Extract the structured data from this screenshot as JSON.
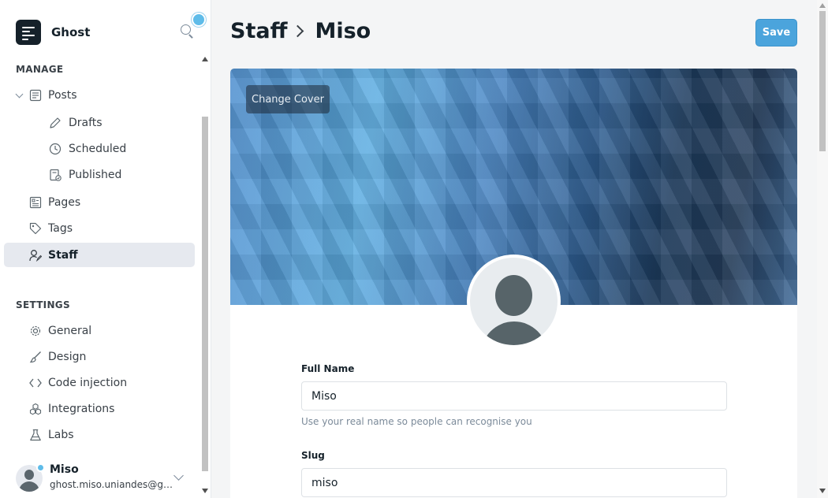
{
  "app": {
    "name": "Ghost"
  },
  "sidebar": {
    "manage_heading": "MANAGE",
    "settings_heading": "SETTINGS",
    "manage_items": [
      {
        "label": "Posts",
        "icon": "posts-icon"
      },
      {
        "label": "Drafts",
        "icon": "pencil-icon"
      },
      {
        "label": "Scheduled",
        "icon": "clock-icon"
      },
      {
        "label": "Published",
        "icon": "published-icon"
      },
      {
        "label": "Pages",
        "icon": "pages-icon"
      },
      {
        "label": "Tags",
        "icon": "tag-icon"
      },
      {
        "label": "Staff",
        "icon": "staff-icon",
        "active": true
      }
    ],
    "settings_items": [
      {
        "label": "General",
        "icon": "gear-icon"
      },
      {
        "label": "Design",
        "icon": "brush-icon"
      },
      {
        "label": "Code injection",
        "icon": "code-icon"
      },
      {
        "label": "Integrations",
        "icon": "integrations-icon"
      },
      {
        "label": "Labs",
        "icon": "flask-icon"
      }
    ],
    "user": {
      "name": "Miso",
      "email": "ghost.miso.uniandes@gmail.com"
    }
  },
  "header": {
    "breadcrumb_parent": "Staff",
    "breadcrumb_current": "Miso",
    "save_label": "Save"
  },
  "profile": {
    "change_cover_label": "Change Cover",
    "full_name_label": "Full Name",
    "full_name_value": "Miso",
    "full_name_hint": "Use your real name so people can recognise you",
    "slug_label": "Slug",
    "slug_value": "miso"
  },
  "colors": {
    "accent": "#4ba4dc",
    "notification": "#5fbce9",
    "active_nav_bg": "#e6e9ef"
  }
}
